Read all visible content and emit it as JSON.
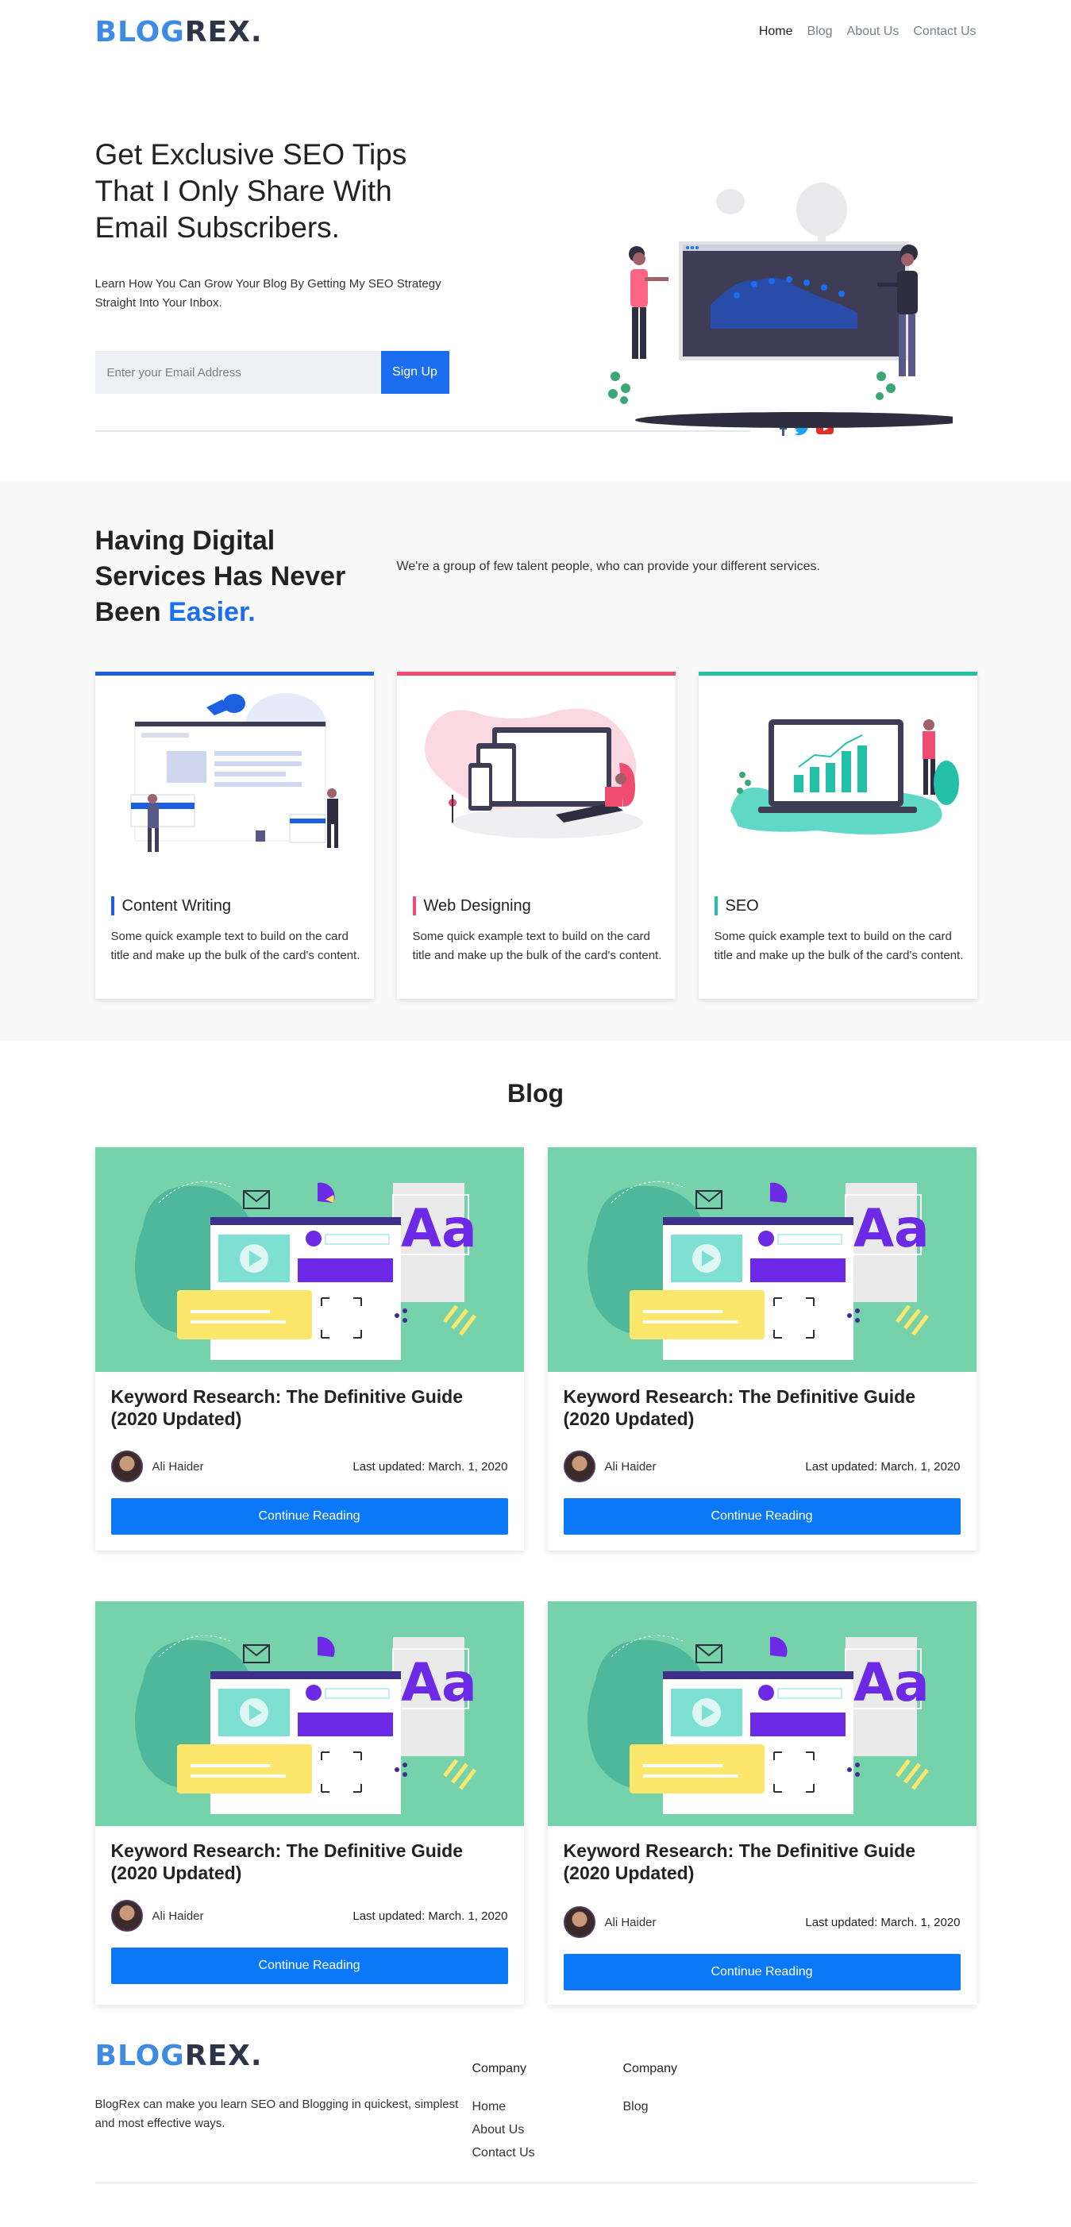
{
  "brand": {
    "logo_part1": "BLOG",
    "logo_part2": "REX."
  },
  "nav": {
    "items": [
      {
        "label": "Home"
      },
      {
        "label": "Blog"
      },
      {
        "label": "About Us"
      },
      {
        "label": "Contact Us"
      }
    ]
  },
  "hero": {
    "title": "Get Exclusive SEO Tips That I Only Share With Email Subscribers.",
    "subtitle": "Learn How You Can Grow Your Blog By Getting My SEO Strategy Straight Into Your Inbox.",
    "email_placeholder": "Enter your Email Address",
    "signup_label": "Sign Up"
  },
  "services": {
    "title_part1": "Having Digital Services Has Never Been ",
    "title_highlight": "Easier.",
    "description": "We're a group of few talent people, who can provide your different services.",
    "cards": [
      {
        "title": "Content Writing",
        "text": "Some quick example text to build on the card title and make up the bulk of the card's content.",
        "accent": "#1c5fe0"
      },
      {
        "title": "Web Designing",
        "text": "Some quick example text to build on the card title and make up the bulk of the card's content.",
        "accent": "#ef4c72"
      },
      {
        "title": "SEO",
        "text": "Some quick example text to build on the card title and make up the bulk of the card's content.",
        "accent": "#23bfa6"
      }
    ]
  },
  "blog": {
    "heading": "Blog",
    "posts": [
      {
        "title": "Keyword Research: The Definitive Guide (2020 Updated)",
        "author": "Ali Haider",
        "updated": "Last updated: March. 1, 2020",
        "button": "Continue Reading"
      },
      {
        "title": "Keyword Research: The Definitive Guide (2020 Updated)",
        "author": "Ali Haider",
        "updated": "Last updated: March. 1, 2020",
        "button": "Continue Reading"
      },
      {
        "title": "Keyword Research: The Definitive Guide (2020 Updated)",
        "author": "Ali Haider",
        "updated": "Last updated: March. 1, 2020",
        "button": "Continue Reading"
      },
      {
        "title": "Keyword Research: The Definitive Guide (2020 Updated)",
        "author": "Ali Haider",
        "updated": "Last updated: March. 1, 2020",
        "button": "Continue Reading"
      }
    ],
    "thumb_text": "Aa"
  },
  "footer": {
    "description": "BlogRex can make you learn SEO and Blogging in quickest, simplest and most effective ways.",
    "col1": {
      "heading": "Company",
      "links": [
        "Home",
        "About Us",
        "Contact Us"
      ]
    },
    "col2": {
      "heading": "Company",
      "links": [
        "Blog"
      ]
    }
  },
  "colors": {
    "primary": "#1c6ef0",
    "button": "#0b79f7",
    "logo_blue": "#3d8be3",
    "logo_dark": "#2e3549",
    "thumb_bg": "#76d2ab"
  }
}
